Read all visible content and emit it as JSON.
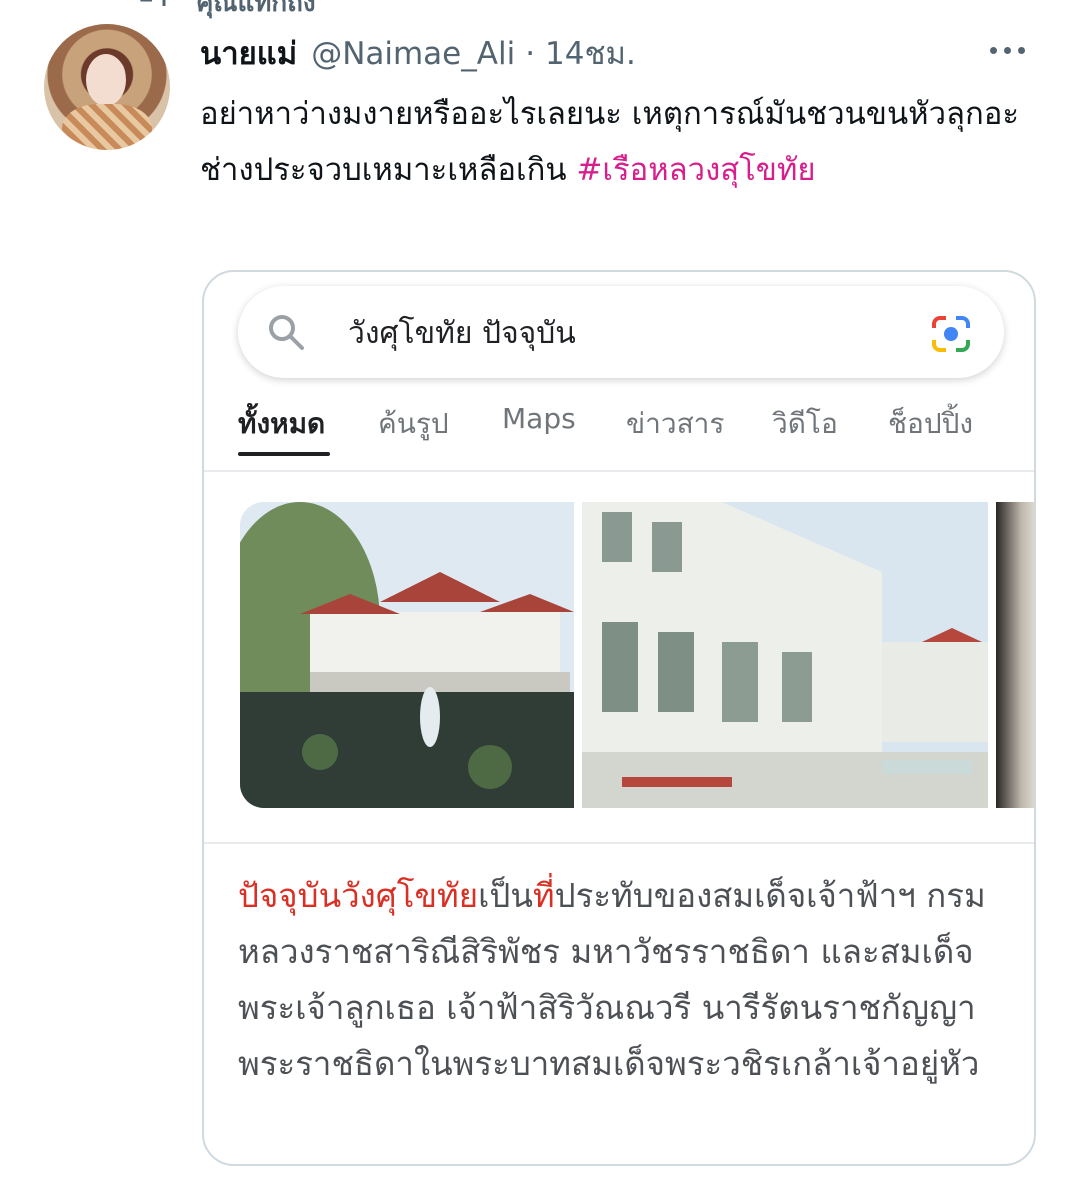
{
  "topline": {
    "label": "คุณแท็กถึง"
  },
  "tweet": {
    "display_name": "นายแม่",
    "handle": "@Naimae_Ali",
    "separator": "·",
    "time": "14ชม.",
    "text": "อย่าหาว่างมงายหรืออะไรเลยนะ เหตุการณ์มันชวนขนหัวลุกอะ ช่างประจวบเหมาะเหลือเกิน ",
    "hashtag": "#เรือหลวงสุโขทัย"
  },
  "embedded_screenshot": {
    "search": {
      "query": "วังศุโขทัย ปัจจุบัน"
    },
    "tabs": [
      {
        "label": "ทั้งหมด",
        "active": true
      },
      {
        "label": "ค้นรูป",
        "active": false
      },
      {
        "label": "Maps",
        "active": false
      },
      {
        "label": "ข่าวสาร",
        "active": false
      },
      {
        "label": "วิดีโอ",
        "active": false
      },
      {
        "label": "ช็อปปิ้ง",
        "active": false
      }
    ],
    "snippet": {
      "highlight": "ปัจจุบันวังศุโขทัย",
      "mid": "เป็น",
      "highlight2": "ที่",
      "rest": "ประทับของสมเด็จเจ้าฟ้าฯ กรมหลวงราชสาริณีสิริพัชร มหาวัชรราชธิดา และสมเด็จพระเจ้าลูกเธอ เจ้าฟ้าสิริวัณณวรี นารีรัตนราชกัญญา พระราชธิดาในพระบาทสมเด็จพระวชิรเกล้าเจ้าอยู่หัว"
    }
  },
  "colors": {
    "hashtag": "#d61f8d",
    "snippet_highlight": "#d93025",
    "secondary_text": "#536471"
  }
}
